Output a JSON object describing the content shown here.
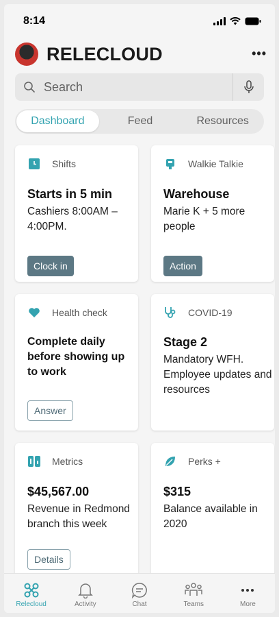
{
  "status": {
    "time": "8:14"
  },
  "app": {
    "title": "RELECLOUD",
    "menu": "•••"
  },
  "search": {
    "placeholder": "Search"
  },
  "tabs": [
    {
      "label": "Dashboard",
      "active": true
    },
    {
      "label": "Feed"
    },
    {
      "label": "Resources"
    }
  ],
  "cards": {
    "shifts": {
      "label": "Shifts",
      "title": "Starts in 5 min",
      "body": "Cashiers 8:00AM – 4:00PM.",
      "button": "Clock in",
      "icon": "clock-icon"
    },
    "walkie": {
      "label": "Walkie Talkie",
      "title": "Warehouse",
      "body": "Marie K + 5 more people",
      "button": "Action",
      "icon": "walkie-talkie-icon"
    },
    "health": {
      "label": "Health check",
      "title": "Complete daily before showing up to work",
      "button": "Answer",
      "icon": "heart-icon"
    },
    "covid": {
      "label": "COVID-19",
      "title": "Stage 2",
      "body": "Mandatory WFH. Employee updates and resources",
      "icon": "stethoscope-icon"
    },
    "metrics": {
      "label": "Metrics",
      "title": "$45,567.00",
      "body": "Revenue in Redmond branch this week",
      "button": "Details",
      "icon": "metrics-icon"
    },
    "perks": {
      "label": "Perks +",
      "title": "$315",
      "body": "Balance available in 2020",
      "icon": "leaf-icon"
    }
  },
  "nav": [
    {
      "label": "Relecloud",
      "icon": "relecloud-icon",
      "active": true
    },
    {
      "label": "Activity",
      "icon": "bell-icon"
    },
    {
      "label": "Chat",
      "icon": "chat-icon"
    },
    {
      "label": "Teams",
      "icon": "teams-icon"
    },
    {
      "label": "More",
      "icon": "more-icon"
    }
  ],
  "colors": {
    "accent": "#33a3b0",
    "button": "#5c7884"
  }
}
